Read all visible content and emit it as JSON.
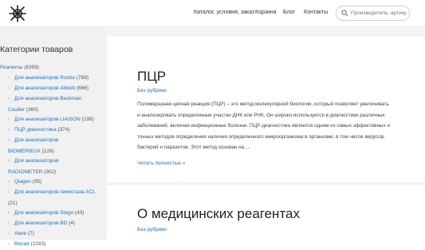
{
  "header": {
    "nav": [
      "Каталог, условия, заказ",
      "Корзина",
      "Блог",
      "Контакты"
    ],
    "search_placeholder": "Производитель, артикул и"
  },
  "sidebar": {
    "title": "Категории товаров",
    "items": [
      {
        "label": "Реагенты",
        "count": "(6399)"
      },
      {
        "label": "Для анализаторов Roche",
        "count": "(789)"
      },
      {
        "label": "Для анализаторов Abbott",
        "count": "(666)"
      },
      {
        "label": "Для анализаторов Beckman Coulter",
        "count": "(360)"
      },
      {
        "label": "Для анализаторов LIAISON",
        "count": "(198)"
      },
      {
        "label": "ПЦР диагностика",
        "count": "(374)"
      },
      {
        "label": "Для анализаторов BIOMERIEUX",
        "count": "(128)"
      },
      {
        "label": "Для анализаторов RADIOMETER",
        "count": "(902)"
      },
      {
        "label": "Qiagen",
        "count": "(95)"
      },
      {
        "label": "Для анализаторов гемостаза ACL",
        "count": "(21)"
      },
      {
        "label": "Для анализаторов Stago",
        "count": "(43)"
      },
      {
        "label": "Для анализаторов BD",
        "count": "(4)"
      },
      {
        "label": "Alere",
        "count": "(7)"
      },
      {
        "label": "Biorad",
        "count": "(2283)"
      }
    ]
  },
  "posts": [
    {
      "title": "ПЦР",
      "category": "Без рубрики",
      "text": "Полимеразная цепная реакция (ПЦР) – это метод молекулярной биологии, который позволяет увеличивать и анализировать определенные участки ДНК или РНК. Он широко используется в диагностике различных заболеваний, включая инфекционные болезни. ПЦР-диагностика является одним из самых эффективных и точных методов определения наличия определенного микроорганизма в организме, в том числе вирусов, бактерий и паразитов. Этот метод основан на …",
      "read_more": "Читать полностью »"
    },
    {
      "title": "О медицинских реагентах",
      "category": "Без рубрики"
    }
  ]
}
